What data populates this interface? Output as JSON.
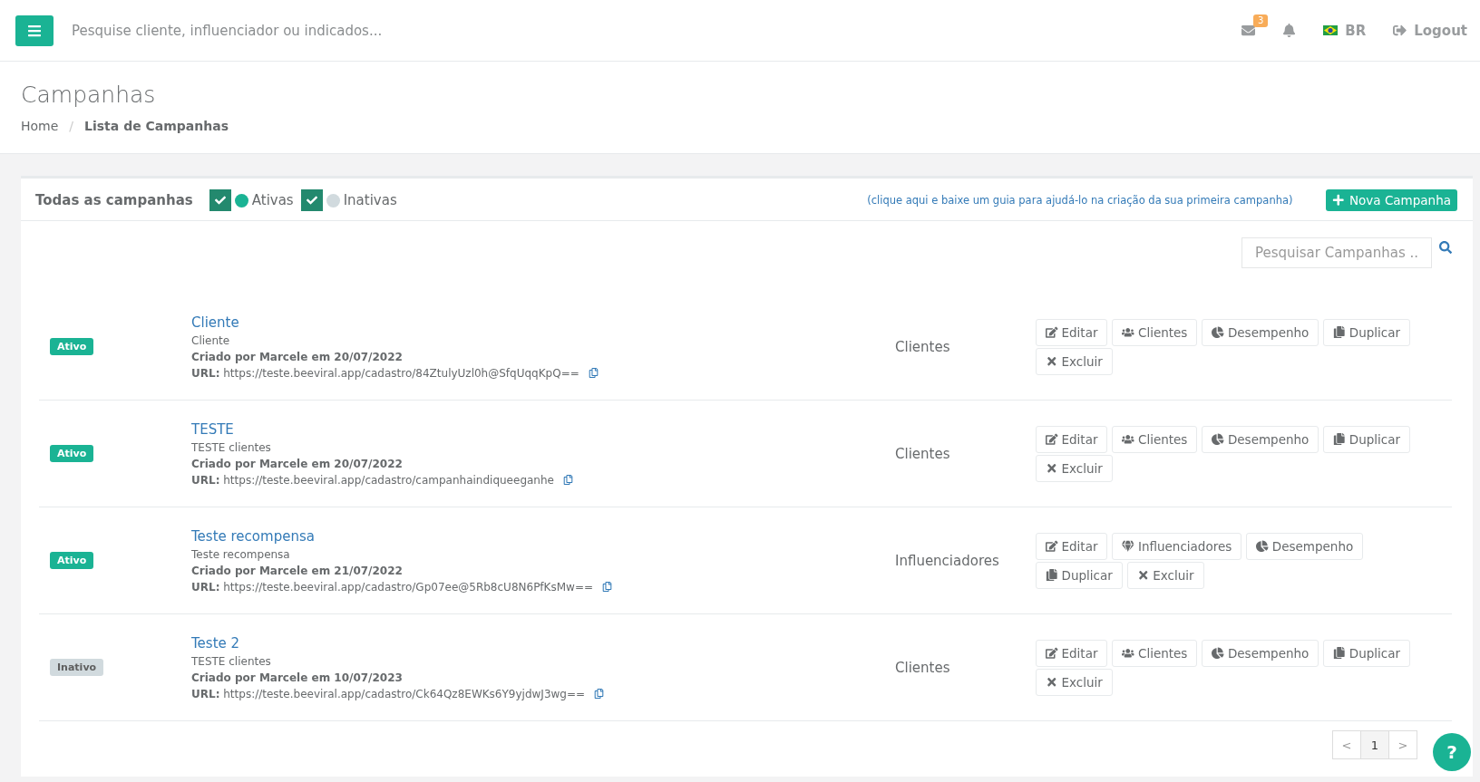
{
  "topbar": {
    "search_placeholder": "Pesquise cliente, influenciador ou indicados...",
    "mail_badge": "3",
    "language": "BR",
    "logout": "Logout"
  },
  "page": {
    "title": "Campanhas",
    "separator": "/",
    "breadcrumb": [
      {
        "label": "Home",
        "current": false
      },
      {
        "label": "Lista de Campanhas",
        "current": true
      }
    ]
  },
  "filters": {
    "title": "Todas as campanhas",
    "items": [
      {
        "label": "Ativas",
        "checked": true,
        "color": "#1ab394"
      },
      {
        "label": "Inativas",
        "checked": true,
        "color": "#d1dade"
      }
    ]
  },
  "guide_link": "(clique aqui e baixe um guia para ajudá-lo na criação da sua primeira campanha)",
  "new_button": "Nova Campanha",
  "search_placeholder": "Pesquisar Campanhas ..",
  "campaigns": [
    {
      "status": "Ativo",
      "active": true,
      "title": "Cliente",
      "subtitle": "Cliente",
      "created": "Criado por Marcele em 20/07/2022",
      "url": "**URL:** https://teste.beeviral.app/cadastro/84ZtulyUzl0h@SfqUqqKpQ==",
      "audience": "Clientes",
      "actions": [
        {
          "kind": "edit",
          "label": "Editar"
        },
        {
          "kind": "people",
          "label": "Clientes"
        },
        {
          "kind": "pie",
          "label": "Desempenho"
        },
        {
          "kind": "copy",
          "label": "Duplicar"
        },
        {
          "kind": "delete",
          "label": "Excluir"
        }
      ]
    },
    {
      "status": "Ativo",
      "active": true,
      "title": "TESTE",
      "subtitle": "TESTE clientes",
      "created": "Criado por Marcele em 20/07/2022",
      "url": "**URL:** https://teste.beeviral.app/cadastro/campanhaindiqueeganhe",
      "audience": "Clientes",
      "actions": [
        {
          "kind": "edit",
          "label": "Editar"
        },
        {
          "kind": "people",
          "label": "Clientes"
        },
        {
          "kind": "pie",
          "label": "Desempenho"
        },
        {
          "kind": "copy",
          "label": "Duplicar"
        },
        {
          "kind": "delete",
          "label": "Excluir"
        }
      ]
    },
    {
      "status": "Ativo",
      "active": true,
      "title": "Teste recompensa",
      "subtitle": "Teste recompensa",
      "created": "Criado por Marcele em 21/07/2022",
      "url": "**URL:** https://teste.beeviral.app/cadastro/Gp07ee@5Rb8cU8N6PfKsMw==",
      "audience": "Influenciadores",
      "actions": [
        {
          "kind": "edit",
          "label": "Editar"
        },
        {
          "kind": "gem",
          "label": "Influenciadores"
        },
        {
          "kind": "pie",
          "label": "Desempenho"
        },
        {
          "kind": "copy",
          "label": "Duplicar"
        },
        {
          "kind": "delete",
          "label": "Excluir"
        }
      ]
    },
    {
      "status": "Inativo",
      "active": false,
      "title": "Teste 2",
      "subtitle": "TESTE clientes",
      "created": "Criado por Marcele em 10/07/2023",
      "url": "**URL:** https://teste.beeviral.app/cadastro/Ck64Qz8EWKs6Y9yjdwJ3wg==",
      "audience": "Clientes",
      "actions": [
        {
          "kind": "edit",
          "label": "Editar"
        },
        {
          "kind": "people",
          "label": "Clientes"
        },
        {
          "kind": "pie",
          "label": "Desempenho"
        },
        {
          "kind": "copy",
          "label": "Duplicar"
        },
        {
          "kind": "delete",
          "label": "Excluir"
        }
      ]
    }
  ],
  "pagination": [
    {
      "label": "<",
      "selected": false
    },
    {
      "label": "1",
      "selected": true
    },
    {
      "label": ">",
      "selected": false
    }
  ],
  "help": "?"
}
